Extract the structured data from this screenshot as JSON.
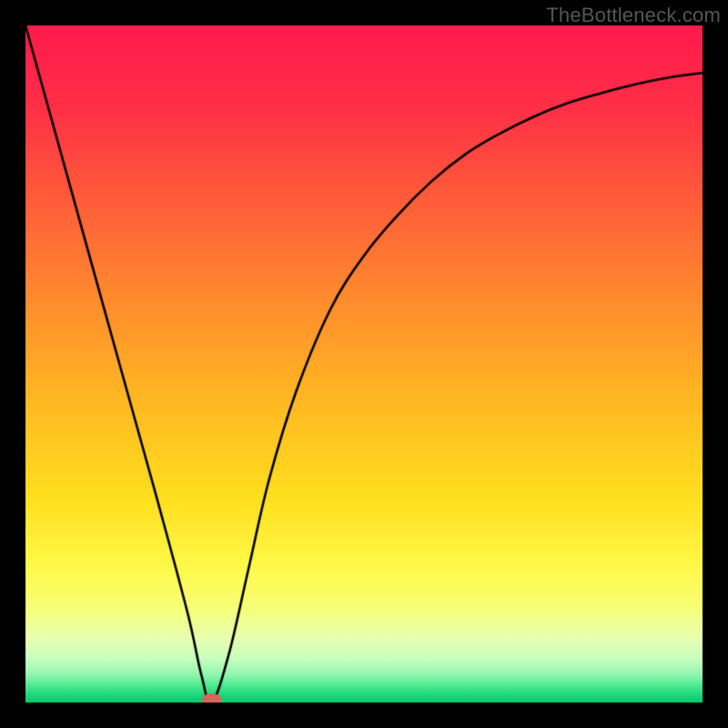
{
  "watermark": "TheBottleneck.com",
  "chart_data": {
    "type": "line",
    "title": "",
    "xlabel": "",
    "ylabel": "",
    "xlim": [
      0,
      100
    ],
    "ylim": [
      0,
      100
    ],
    "grid": false,
    "legend": false,
    "series": [
      {
        "name": "bottleneck-curve",
        "x": [
          0,
          5,
          10,
          15,
          20,
          24,
          26,
          27.5,
          30,
          33,
          36,
          40,
          45,
          50,
          55,
          60,
          65,
          70,
          75,
          80,
          85,
          90,
          95,
          100
        ],
        "y": [
          100,
          82,
          64,
          46,
          28,
          13,
          4,
          0,
          7,
          20,
          33,
          46,
          58,
          66,
          72,
          77,
          81,
          84,
          86.5,
          88.5,
          90,
          91.3,
          92.3,
          93
        ]
      }
    ],
    "marker": {
      "name": "optimal-point",
      "x": 27.5,
      "y": 0,
      "color": "#d8655a",
      "rx": 11,
      "ry": 7
    },
    "background_gradient": {
      "stops": [
        {
          "pos": 0.0,
          "color": "#ff1a4d"
        },
        {
          "pos": 0.12,
          "color": "#ff2f46"
        },
        {
          "pos": 0.25,
          "color": "#ff5a3a"
        },
        {
          "pos": 0.4,
          "color": "#ff8a2e"
        },
        {
          "pos": 0.55,
          "color": "#ffb722"
        },
        {
          "pos": 0.7,
          "color": "#ffe01e"
        },
        {
          "pos": 0.8,
          "color": "#fff94a"
        },
        {
          "pos": 0.86,
          "color": "#f7ff77"
        },
        {
          "pos": 0.905,
          "color": "#e8ffb0"
        },
        {
          "pos": 0.935,
          "color": "#c8ffbf"
        },
        {
          "pos": 0.958,
          "color": "#94f7b0"
        },
        {
          "pos": 0.975,
          "color": "#4fe991"
        },
        {
          "pos": 0.992,
          "color": "#12d477"
        },
        {
          "pos": 1.0,
          "color": "#04c96c"
        }
      ]
    }
  }
}
